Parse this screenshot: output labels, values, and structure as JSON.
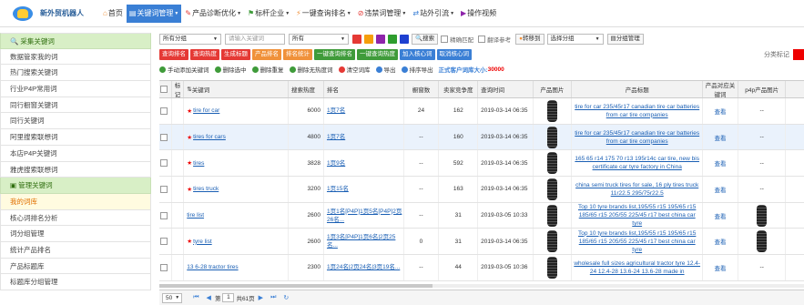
{
  "header": {
    "brand": "新外贸机器人",
    "nav": [
      {
        "icon": "home-icon",
        "label": "首页",
        "active": false
      },
      {
        "icon": "keyword-icon",
        "label": "关键词管理",
        "active": true
      },
      {
        "icon": "diagnose-icon",
        "label": "产品诊断优化",
        "active": false
      },
      {
        "icon": "benchmark-icon",
        "label": "标杆企业",
        "active": false
      },
      {
        "icon": "query-icon",
        "label": "一键查询排名",
        "active": false
      },
      {
        "icon": "banned-icon",
        "label": "违禁词管理",
        "active": false
      },
      {
        "icon": "traffic-icon",
        "label": "站外引流",
        "active": false
      },
      {
        "icon": "video-icon",
        "label": "操作视频",
        "active": false
      }
    ]
  },
  "sidebar": {
    "groups": [
      {
        "title": "采集关键词",
        "items": [
          "数据管家我的词",
          "热门搜索关键词",
          "行业P4P常用词",
          "同行橱窗关键词",
          "同行关键词",
          "阿里搜索联想词",
          "本店P4P关键词",
          "雅虎搜索联想词"
        ]
      },
      {
        "title": "管理关键词",
        "items": [
          "我的词库",
          "核心词排名分析",
          "词分组管理",
          "统计产品排名",
          "产品标题库",
          "标题库分组管理"
        ]
      }
    ],
    "current": "我的词库"
  },
  "toolbar": {
    "group_select": "所有分组",
    "keyword_placeholder": "请输入关键词",
    "filter_select": "所有",
    "color_swatches": [
      "#e53935",
      "#f59e0b",
      "#8e24aa",
      "#2e9d2e",
      "#1e40d0"
    ],
    "search_label": "搜索",
    "fuzzy_label": "精确匹配",
    "translate_label": "翻译参考",
    "move_label": "转移到",
    "select_group": "选择分组",
    "group_manage": "分组管理",
    "buttons": [
      {
        "label": "查询排名",
        "color": "red"
      },
      {
        "label": "查询热度",
        "color": "red"
      },
      {
        "label": "生成标题",
        "color": "red"
      },
      {
        "label": "产品排名",
        "color": "orange"
      },
      {
        "label": "排名统计",
        "color": "orange"
      },
      {
        "label": "一键查询排名",
        "color": "green"
      },
      {
        "label": "一键查询热度",
        "color": "green"
      },
      {
        "label": "加入核心词",
        "color": "blue"
      },
      {
        "label": "取消核心词",
        "color": "blue"
      }
    ],
    "category_label": "分类标记",
    "actions": [
      {
        "label": "手动添加关键词",
        "color": "#3f9b3a"
      },
      {
        "label": "删除选中",
        "color": "#3f9b3a"
      },
      {
        "label": "删除重复",
        "color": "#3f9b3a"
      },
      {
        "label": "删除无热度词",
        "color": "#3f9b3a"
      },
      {
        "label": "清空词库",
        "color": "#e53935"
      },
      {
        "label": "导出",
        "color": "#3a7fd5"
      },
      {
        "label": "排序导出",
        "color": "#3a7fd5"
      }
    ],
    "warning_prefix": "正式客户词库大小:",
    "warning_value": "30000"
  },
  "table": {
    "headers": {
      "mark": "标记",
      "keyword": "关键词",
      "heat": "搜索热度",
      "rank": "排名",
      "index": "橱窗数",
      "competition": "卖家竞争度",
      "time": "查询时间",
      "image": "产品图片",
      "title": "产品标题",
      "link": "产品对应关键词",
      "p4p": "p4p产品图片"
    },
    "rows": [
      {
        "starred": true,
        "keyword": "tire for car",
        "heat": "6000",
        "rank": "1页7名",
        "index": "24",
        "competition": "162",
        "time": "2019-03-14 06:35",
        "title": "tire for car 235/45r17 canadian tire car batteries from car tire companies",
        "link": "查看",
        "p4p": "--",
        "img": true,
        "p4pimg": false
      },
      {
        "starred": true,
        "keyword": "tires for cars",
        "heat": "4800",
        "rank": "1页7名",
        "index": "--",
        "competition": "160",
        "time": "2019-03-14 06:35",
        "title": "tire for car 235/45r17 canadian tire car batteries from car tire companies",
        "link": "查看",
        "p4p": "--",
        "img": true,
        "p4pimg": false
      },
      {
        "starred": true,
        "keyword": "tires",
        "heat": "3828",
        "rank": "1页9名",
        "index": "--",
        "competition": "592",
        "time": "2019-03-14 06:35",
        "title": "165 65 r14 175 70 r13 195r14c car tire, new bis certificate car tyre factory in China",
        "link": "查看",
        "p4p": "--",
        "img": true,
        "p4pimg": false
      },
      {
        "starred": true,
        "keyword": "tires truck",
        "heat": "3200",
        "rank": "1页15名",
        "index": "--",
        "competition": "163",
        "time": "2019-03-14 06:35",
        "title": "china semi truck tires for sale, 16 ply tires truck 11r22.5 295/75r22.5",
        "link": "查看",
        "p4p": "--",
        "img": true,
        "p4pimg": false
      },
      {
        "starred": false,
        "keyword": "tire list",
        "heat": "2600",
        "rank": "1页1名[P4P]1页5名[P4P]2页26名...",
        "index": "--",
        "competition": "31",
        "time": "2019-03-05 10:33",
        "title": "Top 10 tyre brands list,195/55 r15 195/65 r15 185/65 r15 205/55 225/45 r17 best china car tyre",
        "link": "查看",
        "p4p": "",
        "img": true,
        "p4pimg": true
      },
      {
        "starred": true,
        "keyword": "tyre list",
        "heat": "2600",
        "rank": "1页3名[P4P]1页6名|2页25名...",
        "index": "0",
        "competition": "31",
        "time": "2019-03-14 06:35",
        "title": "Top 10 tyre brands list,195/55 r15 195/65 r15 185/65 r15 205/55 225/45 r17 best china car tyre",
        "link": "查看",
        "p4p": "",
        "img": true,
        "p4pimg": true
      },
      {
        "starred": false,
        "keyword": "13 6-28 tractor tires",
        "heat": "2300",
        "rank": "1页24名|2页24名|3页19名...",
        "index": "--",
        "competition": "44",
        "time": "2019-03-05 10:36",
        "title": "wholesale full sizes agricultural tractor tyre 12.4-24 12.4-28 13.6-24 13.6-28 made in",
        "link": "查看",
        "p4p": "--",
        "img": true,
        "p4pimg": false
      }
    ]
  },
  "pager": {
    "page_size": "50",
    "page_prefix": "第",
    "page": "1",
    "page_suffix": "共61页"
  }
}
